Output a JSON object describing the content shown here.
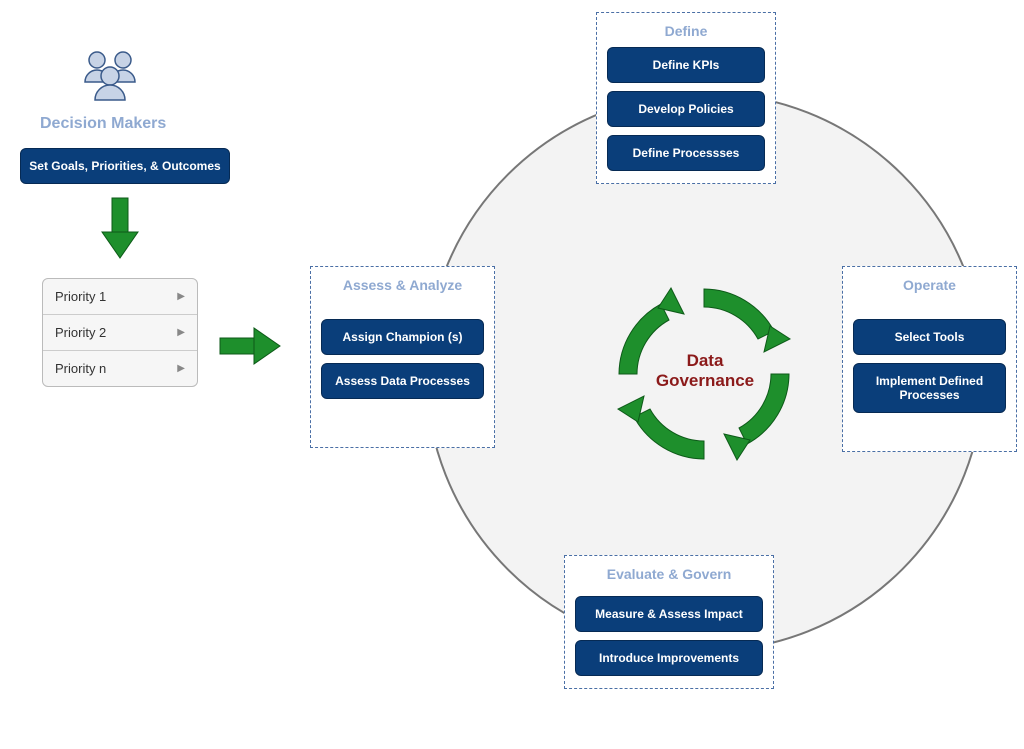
{
  "decisionMakers": {
    "title": "Decision Makers",
    "goalButton": "Set Goals,  Priorities, & Outcomes"
  },
  "priorities": {
    "items": [
      "Priority 1",
      "Priority 2",
      "Priority n"
    ]
  },
  "center": {
    "line1": "Data",
    "line2": "Governance"
  },
  "boxes": {
    "assess": {
      "title": "Assess & Analyze",
      "items": [
        "Assign Champion (s)",
        "Assess Data Processes"
      ]
    },
    "define": {
      "title": "Define",
      "items": [
        "Define  KPIs",
        "Develop Policies",
        "Define Processses"
      ]
    },
    "operate": {
      "title": "Operate",
      "items": [
        "Select Tools",
        "Implement Defined Processes"
      ]
    },
    "evaluate": {
      "title": "Evaluate & Govern",
      "items": [
        "Measure & Assess Impact",
        "Introduce Improvements"
      ]
    }
  },
  "colors": {
    "accent": "#0a3e7a",
    "arrow": "#1e8f2c",
    "circleFill": "#f3f3f3"
  }
}
